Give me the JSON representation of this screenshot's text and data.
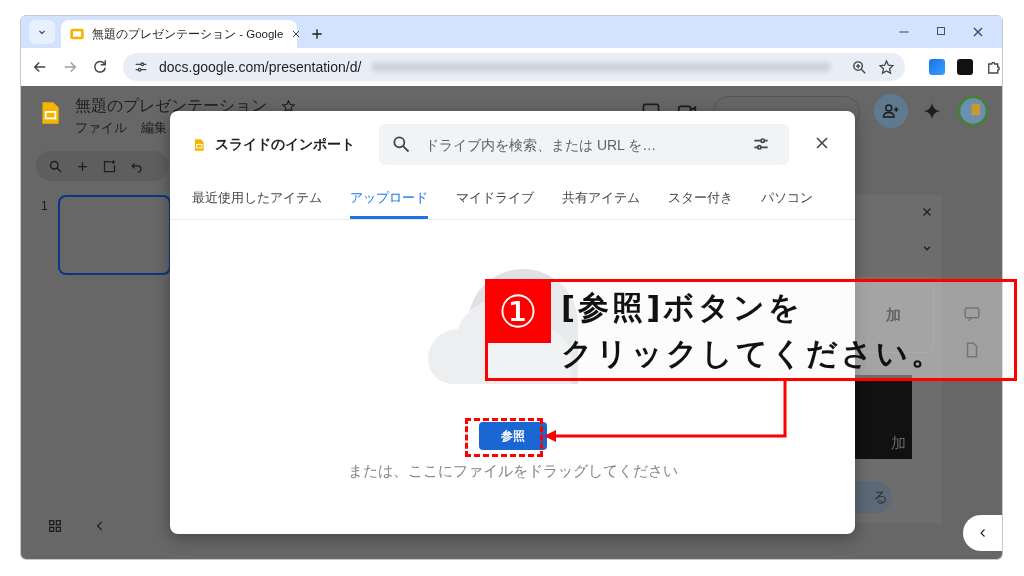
{
  "browser": {
    "tab_title": "無題のプレゼンテーション - Google",
    "url": "docs.google.com/presentation/d/"
  },
  "app": {
    "doc_title": "無題のプレゼンテーション",
    "menu": [
      "ファイル",
      "編集"
    ],
    "slide_number": "1",
    "panel_texts": [
      "加",
      "加",
      "る"
    ]
  },
  "dialog": {
    "title": "スライドのインポート",
    "search": {
      "placeholder": "ドライブ内を検索、または URL を…"
    },
    "tabs": [
      {
        "label": "最近使用したアイテム",
        "selected": false
      },
      {
        "label": "アップロード",
        "selected": true
      },
      {
        "label": "マイドライブ",
        "selected": false
      },
      {
        "label": "共有アイテム",
        "selected": false
      },
      {
        "label": "スター付き",
        "selected": false
      },
      {
        "label": "パソコン",
        "selected": false
      }
    ],
    "button": "参照",
    "hint": "または、ここにファイルをドラッグしてください"
  },
  "callout": {
    "step": "①",
    "lines": [
      "[参照]ボタンを",
      "クリックしてください。"
    ]
  }
}
